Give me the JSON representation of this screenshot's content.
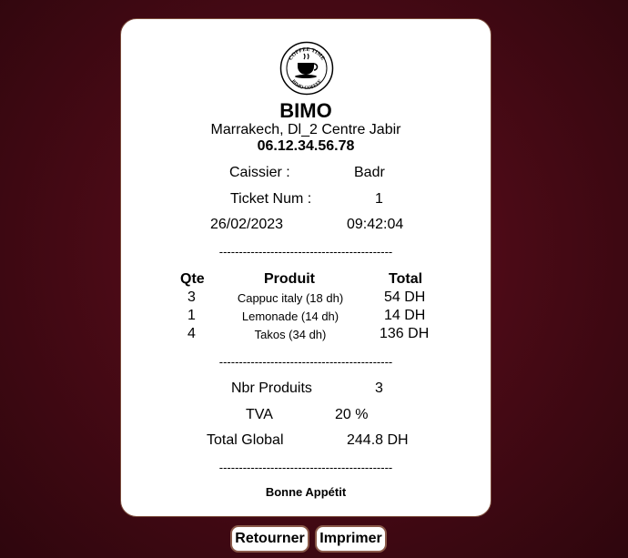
{
  "logo": {
    "top_text": "COFFEE TIME",
    "bottom_text": "BIMO COFFEE",
    "icon": "coffee-cup-icon"
  },
  "store": {
    "name": "BIMO",
    "address": "Marrakech, Dl_2 Centre Jabir",
    "phone": "06.12.34.56.78"
  },
  "info": {
    "cashier_label": "Caissier :",
    "cashier_value": "Badr",
    "ticket_label": "Ticket Num :",
    "ticket_value": "1",
    "date": "26/02/2023",
    "time": "09:42:04"
  },
  "separator": "--------------------------------------------",
  "table": {
    "headers": {
      "qty": "Qte",
      "product": "Produit",
      "total": "Total"
    },
    "rows": [
      {
        "qty": "3",
        "product": "Cappuc italy (18 dh)",
        "total": "54 DH"
      },
      {
        "qty": "1",
        "product": "Lemonade (14 dh)",
        "total": "14 DH"
      },
      {
        "qty": "4",
        "product": "Takos (34 dh)",
        "total": "136 DH"
      }
    ]
  },
  "summary": {
    "nbr_label": "Nbr Produits",
    "nbr_value": "3",
    "tva_label": "TVA",
    "tva_value": "20 %",
    "total_label": "Total Global",
    "total_value": "244.8 DH"
  },
  "footer": "Bonne Appétit",
  "buttons": {
    "back": "Retourner",
    "print": "Imprimer"
  }
}
